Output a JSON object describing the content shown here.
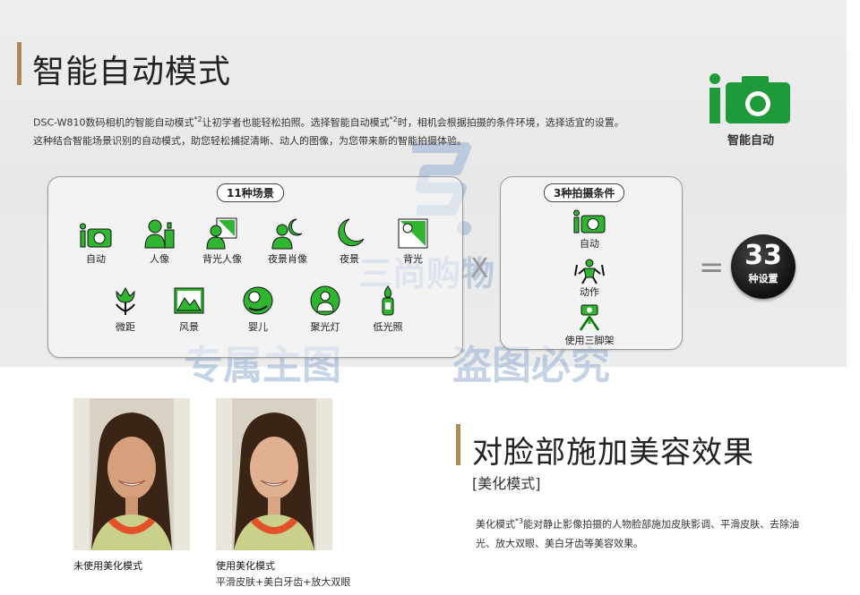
{
  "section1": {
    "title": "智能自动模式",
    "desc_line1_a": "DSC-W810数码相机的智能自动模式",
    "desc_line1_sup1": "*2",
    "desc_line1_b": "让初学者也能轻松拍照。选择智能自动模式",
    "desc_line1_sup2": "*2",
    "desc_line1_c": "时，相机会根据拍摄的条件环境，选择适宜的设置。",
    "desc_line2": "这种结合智能场景识别的自动模式，助您轻松捕捉清晰、动人的图像，为您带来新的智能拍摄体验。",
    "logo_label": "智能自动",
    "logo_icon": "intelligent-auto-camera-icon"
  },
  "scenes": {
    "pill": "11种场景",
    "items": [
      {
        "label": "自动",
        "icon": "auto-camera-icon"
      },
      {
        "label": "人像",
        "icon": "portrait-icon"
      },
      {
        "label": "背光人像",
        "icon": "backlight-portrait-icon"
      },
      {
        "label": "夜景肖像",
        "icon": "night-portrait-icon"
      },
      {
        "label": "夜景",
        "icon": "night-scene-icon"
      },
      {
        "label": "背光",
        "icon": "backlight-icon"
      },
      {
        "label": "微距",
        "icon": "macro-icon"
      },
      {
        "label": "风景",
        "icon": "landscape-icon"
      },
      {
        "label": "婴儿",
        "icon": "baby-icon"
      },
      {
        "label": "聚光灯",
        "icon": "spotlight-icon"
      },
      {
        "label": "低光照",
        "icon": "low-light-icon"
      }
    ]
  },
  "conditions": {
    "pill": "3种拍摄条件",
    "items": [
      {
        "label": "自动",
        "icon": "auto-camera-icon"
      },
      {
        "label": "动作",
        "icon": "motion-icon"
      },
      {
        "label": "使用三脚架",
        "icon": "tripod-icon"
      }
    ]
  },
  "operators": {
    "times": "X",
    "equals": "="
  },
  "result": {
    "number": "33",
    "label": "种设置"
  },
  "watermark": {
    "line1": "三尚购物",
    "line2a": "专属主图",
    "line2b": "盗图必究"
  },
  "section2": {
    "title": "对脸部施加美容效果",
    "subtitle": "[美化模式]",
    "body_a": "美化模式",
    "body_sup": "*3",
    "body_b": "能对静止影像拍摄的人物脸部施加皮肤影调、平滑皮肤、去除油",
    "body_line2": "光、放大双眼、美白牙齿等美容效果。",
    "photo1_caption": "未使用美化模式",
    "photo2_caption": "使用美化模式",
    "photo2_sub": "平滑皮肤+美白牙齿+放大双眼"
  },
  "colors": {
    "accent_bar": "#b08a55",
    "icon_green": "#2fb52f",
    "logo_green": "#1f9a3a"
  }
}
